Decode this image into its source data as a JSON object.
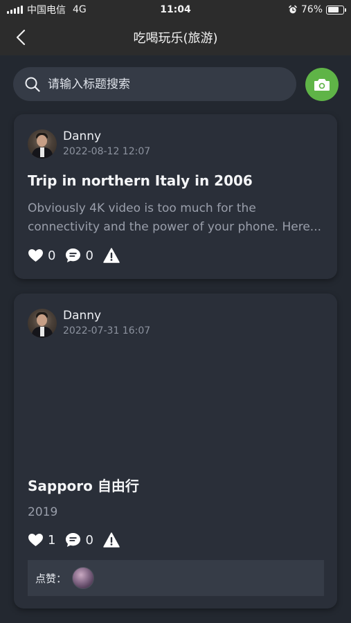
{
  "status_bar": {
    "carrier": "中国电信",
    "network": "4G",
    "time": "11:04",
    "battery": "76%",
    "battery_level": 0.76
  },
  "nav": {
    "title": "吃喝玩乐(旅游)",
    "back_icon": "chevron-left-icon"
  },
  "search": {
    "placeholder": "请输入标题搜索",
    "value": "",
    "camera_icon": "camera-icon",
    "camera_color": "#5fb447"
  },
  "posts": [
    {
      "author": "Danny",
      "time": "2022-08-12 12:07",
      "title": "Trip in northern Italy in 2006",
      "excerpt": "Obviously 4K video is too much for the connectivity and the power of your phone. Here...",
      "likes": "0",
      "comments": "0"
    },
    {
      "author": "Danny",
      "time": "2022-07-31 16:07",
      "title": "Sapporo 自由行",
      "excerpt": "2019",
      "likes": "1",
      "comments": "0",
      "like_label": "点赞："
    }
  ],
  "colors": {
    "background": "#232830",
    "card": "#2a2f39",
    "bar": "#2c2c2c",
    "accent": "#5fb447"
  }
}
